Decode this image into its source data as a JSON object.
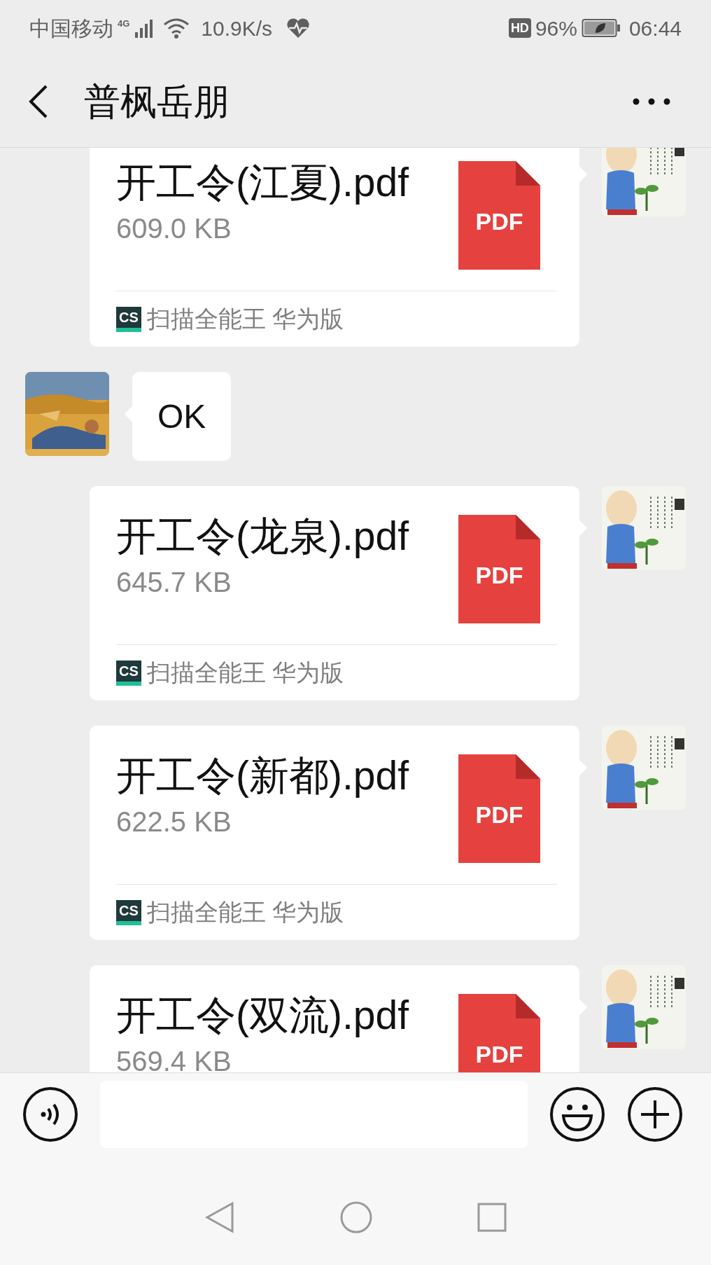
{
  "status_bar": {
    "carrier": "中国移动",
    "network": "4G",
    "speed": "10.9K/s",
    "hd": "HD",
    "battery": "96%",
    "time": "06:44"
  },
  "header": {
    "title": "普枫岳朋"
  },
  "messages": [
    {
      "kind": "file",
      "outgoing": true,
      "name": "开工令(江夏).pdf",
      "size": "609.0 KB",
      "file_type": "PDF",
      "source_logo": "CS",
      "source": "扫描全能王 华为版"
    },
    {
      "kind": "text",
      "outgoing": false,
      "text": "OK"
    },
    {
      "kind": "file",
      "outgoing": true,
      "name": "开工令(龙泉).pdf",
      "size": "645.7 KB",
      "file_type": "PDF",
      "source_logo": "CS",
      "source": "扫描全能王 华为版"
    },
    {
      "kind": "file",
      "outgoing": true,
      "name": "开工令(新都).pdf",
      "size": "622.5 KB",
      "file_type": "PDF",
      "source_logo": "CS",
      "source": "扫描全能王 华为版"
    },
    {
      "kind": "file",
      "outgoing": true,
      "name": "开工令(双流).pdf",
      "size": "569.4 KB",
      "file_type": "PDF"
    }
  ]
}
